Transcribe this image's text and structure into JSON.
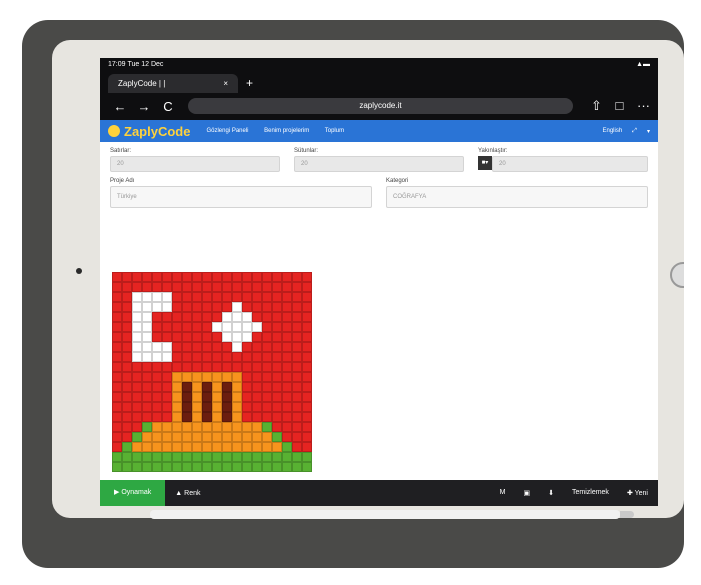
{
  "status": {
    "time": "17:09",
    "date": "Tue 12 Dec",
    "signal": "▲▬"
  },
  "browser": {
    "tab_title": "ZaplyCode | |",
    "tab_close": "×",
    "new_tab": "+",
    "back": "←",
    "forward": "→",
    "reload": "C",
    "url": "zaplycode.it",
    "share": "⇧",
    "tabs": "□",
    "more": "···"
  },
  "app": {
    "logo": "ZaplyCode",
    "nav": [
      "Gözlengi Paneli",
      "Benim projelerim",
      "Toplum"
    ],
    "language": "English",
    "fullscreen": "⤢",
    "user": "▾"
  },
  "form": {
    "rows_label": "Satırlar:",
    "rows_value": "20",
    "cols_label": "Sütunlar:",
    "cols_value": "20",
    "tools_label": "Yakınlaştır:",
    "tools_value": "20",
    "project_label": "Proje Adı",
    "project_placeholder": "Türkiye",
    "category_label": "Kategori",
    "category_value": "COĞRAFYA"
  },
  "toolbar": {
    "run": "▶ Oynamak",
    "paint": "▲ Renk",
    "icon1": "M",
    "icon2": "▣",
    "icon3": "⬇",
    "clear": "Temizlemek",
    "new": "✚ Yeni"
  },
  "colors": {
    "red": "#e52421",
    "white": "#ffffff",
    "orange": "#f7941d",
    "brown": "#6b1d0f",
    "green": "#58b132",
    "bg": "#e52421"
  }
}
